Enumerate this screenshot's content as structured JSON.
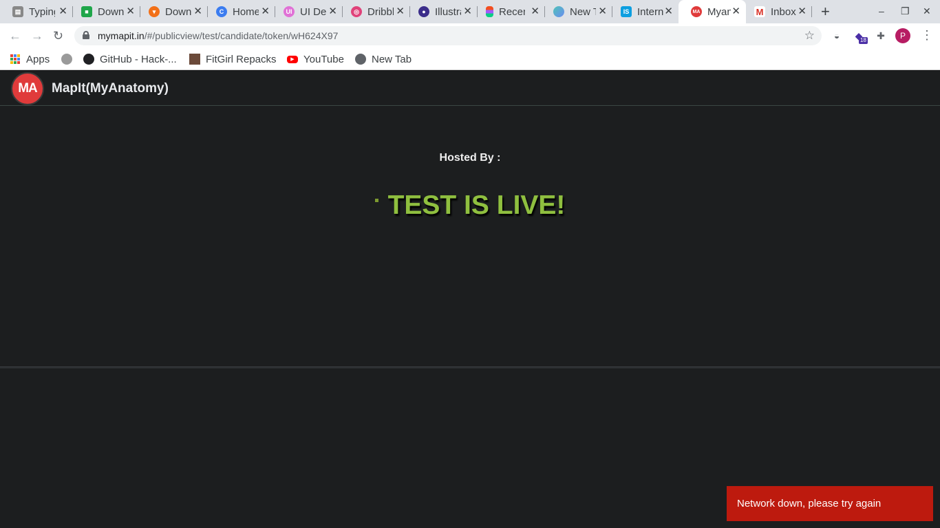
{
  "browser": {
    "tabs": [
      {
        "title": "Typing",
        "favicon": "typing-icon",
        "color": "#888888"
      },
      {
        "title": "Download",
        "favicon": "download-green-icon",
        "color": "#1fa64a"
      },
      {
        "title": "Download",
        "favicon": "brave-icon",
        "color": "#f27018"
      },
      {
        "title": "Home",
        "favicon": "canva-icon",
        "color": "#3b7cf0"
      },
      {
        "title": "UI Design",
        "favicon": "ui-icon",
        "color": "#e071d6"
      },
      {
        "title": "Dribbble",
        "favicon": "dribbble-icon",
        "color": "#e0427a"
      },
      {
        "title": "Illustrations",
        "favicon": "illustration-icon",
        "color": "#3b2d8a"
      },
      {
        "title": "Recent",
        "favicon": "figma-icon",
        "color": "#f24e1e"
      },
      {
        "title": "New Tab",
        "favicon": "gradient-icon",
        "color": "#4fc3b8"
      },
      {
        "title": "Internshala",
        "favicon": "internshala-icon",
        "color": "#0d9fe0"
      },
      {
        "title": "Myanatomy",
        "favicon": "myanatomy-icon",
        "color": "#e03b3b"
      },
      {
        "title": "Inbox",
        "favicon": "gmail-icon",
        "color": "#d93025"
      }
    ],
    "new_tab": "+",
    "window_controls": {
      "minimize": "–",
      "restore": "❐",
      "close": "✕"
    },
    "url_host": "mymapit.in",
    "url_path": "/#/publicview/test/candidate/token/wH624X97",
    "extension_badge": "18",
    "profile_initial": "P",
    "bookmarks": [
      {
        "label": "Apps",
        "icon": "apps-grid-icon"
      },
      {
        "label": "",
        "icon": "circle-bookmark-icon"
      },
      {
        "label": "GitHub - Hack-...",
        "icon": "github-icon"
      },
      {
        "label": "FitGirl Repacks",
        "icon": "fitgirl-icon"
      },
      {
        "label": "YouTube",
        "icon": "youtube-icon"
      },
      {
        "label": "New Tab",
        "icon": "globe-icon"
      }
    ]
  },
  "app": {
    "logo_text": "MA",
    "title": "MapIt(MyAnatomy)",
    "hosted_by": "Hosted By :",
    "status": "TEST IS LIVE!",
    "toast": "Network down, please try again",
    "colors": {
      "accent": "#8fbf3f",
      "logo": "#e03b3b",
      "toast": "#bd1a0e",
      "background": "#1c1e1f"
    }
  }
}
